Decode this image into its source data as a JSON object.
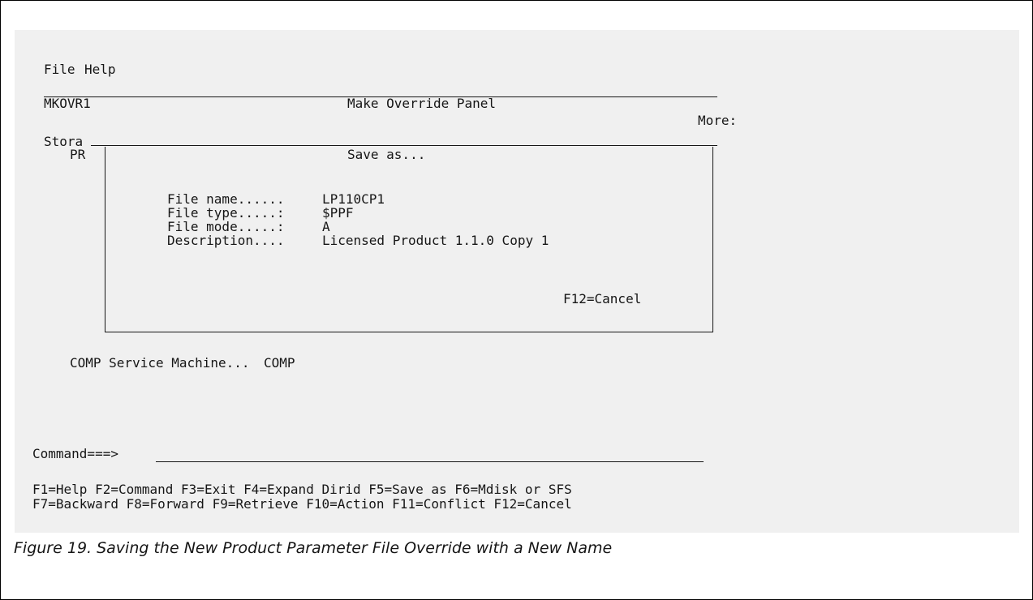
{
  "menu_bar": {
    "file": "File",
    "help": "Help"
  },
  "panel": {
    "id": "MKOVR1",
    "title": "Make Override Panel",
    "more_indicator": "More:",
    "storage_label_partial": "Stora",
    "pr_label_partial": "PR",
    "comp_service_machine_label": "COMP Service Machine...",
    "comp_service_machine_value": "COMP"
  },
  "dialog": {
    "title": "Save as...",
    "fields": [
      {
        "label": "File name......",
        "value": "LP110CP1"
      },
      {
        "label": "File type.....:",
        "value": "$PPF"
      },
      {
        "label": "File mode.....:",
        "value": "A"
      },
      {
        "label": "Description....",
        "value": "Licensed Product 1.1.0 Copy 1"
      }
    ],
    "cancel_key": "F12=Cancel"
  },
  "command": {
    "label": "Command===>",
    "value": ""
  },
  "function_keys": {
    "row1": [
      "F1=Help",
      "F2=Command",
      "F3=Exit",
      "F4=Expand Dirid",
      "F5=Save as",
      "F6=Mdisk or SFS"
    ],
    "row2": [
      "F7=Backward",
      "F8=Forward",
      "F9=Retrieve",
      "F10=Action",
      "F11=Conflict",
      "F12=Cancel"
    ]
  },
  "caption": "Figure 19. Saving the New Product Parameter File Override with a New Name"
}
